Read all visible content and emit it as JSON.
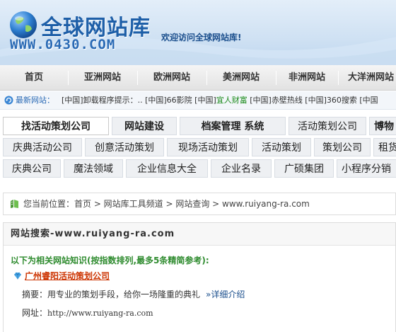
{
  "header": {
    "logo_title": "全球网站库",
    "logo_url": "WWW.0430.COM",
    "welcome": "欢迎访问全球网站库!"
  },
  "nav": {
    "items": [
      "首页",
      "亚洲网站",
      "欧洲网站",
      "美洲网站",
      "非洲网站",
      "大洋洲网站"
    ]
  },
  "ticker": {
    "label": "最新网站：",
    "entries_before": "[中国]卸载程序提示：.. [中国]66影院 [中国]",
    "highlight": "宜人财富",
    "entries_after": " [中国]赤壁热线 [中国]360搜索 [中国"
  },
  "tags": {
    "row1": [
      "找活动策划公司",
      "网站建设",
      "档案管理 系统",
      "活动策划公司",
      "博物"
    ],
    "row2": [
      "庆典活动公司",
      "创意活动策划",
      "现场活动策划",
      "活动策划",
      "策划公司",
      "租货"
    ],
    "row3": [
      "庆典公司",
      "魔法领域",
      "企业信息大全",
      "企业名录",
      "广硕集团",
      "小程序分销"
    ]
  },
  "breadcrumb": {
    "text": "您当前位置：首页 > 网站库工具频道 > 网站查询 > www.ruiyang-ra.com"
  },
  "panel": {
    "title": "网站搜索-www.ruiyang-ra.com",
    "intro": "以下为相关网站知识(按指数排列,最多5条精简参考):",
    "result_title": "广州睿阳活动策划公司",
    "summary_label": "摘要：用专业的策划手段，给你一场隆重的典礼",
    "summary_more": "»详细介绍",
    "url_label": "网址：",
    "url_value": "http://www.ruiyang-ra.com"
  },
  "colors": {
    "brand_blue": "#1e5fa8",
    "intro_green": "#2e8b2e",
    "result_red": "#cc3300"
  },
  "icons": [
    "globe-logo-icon",
    "refresh-icon",
    "location-icon",
    "gem-icon"
  ]
}
